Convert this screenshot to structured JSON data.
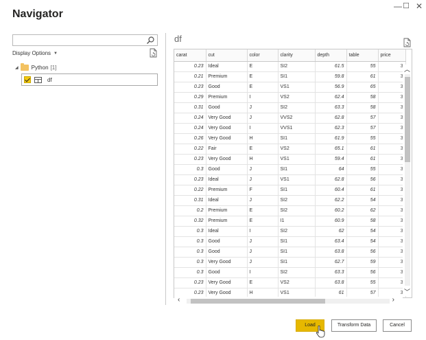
{
  "window": {
    "title": "Navigator",
    "minimize_glyph": "—",
    "maximize_glyph": "☐",
    "close_glyph": "✕"
  },
  "left_pane": {
    "search_value": "",
    "display_options_label": "Display Options",
    "tree": {
      "folder_label": "Python",
      "folder_count": "[1]",
      "items": [
        {
          "label": "df",
          "checked": true
        }
      ]
    }
  },
  "preview": {
    "title": "df",
    "columns": [
      "carat",
      "cut",
      "color",
      "clarity",
      "depth",
      "table",
      "price"
    ],
    "rows": [
      [
        "0.23",
        "Ideal",
        "E",
        "SI2",
        "61.5",
        "55",
        "3"
      ],
      [
        "0.21",
        "Premium",
        "E",
        "SI1",
        "59.8",
        "61",
        "3"
      ],
      [
        "0.23",
        "Good",
        "E",
        "VS1",
        "56.9",
        "65",
        "3"
      ],
      [
        "0.29",
        "Premium",
        "I",
        "VS2",
        "62.4",
        "58",
        "3"
      ],
      [
        "0.31",
        "Good",
        "J",
        "SI2",
        "63.3",
        "58",
        "3"
      ],
      [
        "0.24",
        "Very Good",
        "J",
        "VVS2",
        "62.8",
        "57",
        "3"
      ],
      [
        "0.24",
        "Very Good",
        "I",
        "VVS1",
        "62.3",
        "57",
        "3"
      ],
      [
        "0.26",
        "Very Good",
        "H",
        "SI1",
        "61.9",
        "55",
        "3"
      ],
      [
        "0.22",
        "Fair",
        "E",
        "VS2",
        "65.1",
        "61",
        "3"
      ],
      [
        "0.23",
        "Very Good",
        "H",
        "VS1",
        "59.4",
        "61",
        "3"
      ],
      [
        "0.3",
        "Good",
        "J",
        "SI1",
        "64",
        "55",
        "3"
      ],
      [
        "0.23",
        "Ideal",
        "J",
        "VS1",
        "62.8",
        "56",
        "3"
      ],
      [
        "0.22",
        "Premium",
        "F",
        "SI1",
        "60.4",
        "61",
        "3"
      ],
      [
        "0.31",
        "Ideal",
        "J",
        "SI2",
        "62.2",
        "54",
        "3"
      ],
      [
        "0.2",
        "Premium",
        "E",
        "SI2",
        "60.2",
        "62",
        "3"
      ],
      [
        "0.32",
        "Premium",
        "E",
        "I1",
        "60.9",
        "58",
        "3"
      ],
      [
        "0.3",
        "Ideal",
        "I",
        "SI2",
        "62",
        "54",
        "3"
      ],
      [
        "0.3",
        "Good",
        "J",
        "SI1",
        "63.4",
        "54",
        "3"
      ],
      [
        "0.3",
        "Good",
        "J",
        "SI1",
        "63.8",
        "56",
        "3"
      ],
      [
        "0.3",
        "Very Good",
        "J",
        "SI1",
        "62.7",
        "59",
        "3"
      ],
      [
        "0.3",
        "Good",
        "I",
        "SI2",
        "63.3",
        "56",
        "3"
      ],
      [
        "0.23",
        "Very Good",
        "E",
        "VS2",
        "63.8",
        "55",
        "3"
      ],
      [
        "0.23",
        "Very Good",
        "H",
        "VS1",
        "61",
        "57",
        "3"
      ]
    ]
  },
  "scroll": {
    "up_glyph": "︿",
    "down_glyph": "﹀",
    "left_glyph": "‹",
    "right_glyph": "›"
  },
  "buttons": {
    "load": "Load",
    "transform": "Transform Data",
    "cancel": "Cancel"
  },
  "colors": {
    "accent": "#e6b800",
    "checkbox": "#f2c811",
    "folder": "#f3c261"
  }
}
